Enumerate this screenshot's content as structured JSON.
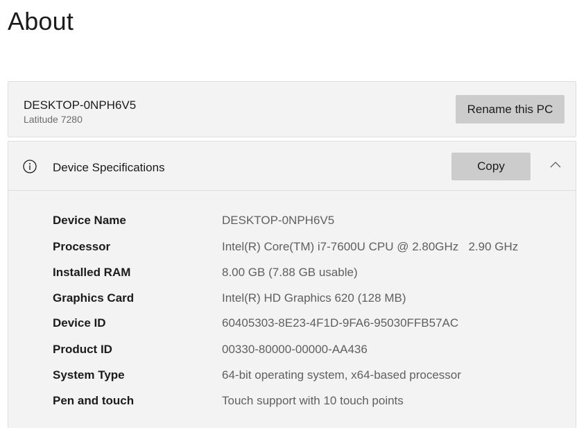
{
  "page": {
    "title": "About"
  },
  "pc": {
    "name": "DESKTOP-0NPH6V5",
    "model": "Latitude 7280",
    "rename_label": "Rename this PC"
  },
  "specs": {
    "title": "Device Specifications",
    "copy_label": "Copy",
    "icons": {
      "info": "info-icon",
      "collapse": "chevron-up-icon"
    },
    "rows": [
      {
        "label": "Device Name",
        "value": "DESKTOP-0NPH6V5"
      },
      {
        "label": "Processor",
        "value": "Intel(R) Core(TM) i7-7600U CPU @ 2.80GHz   2.90 GHz"
      },
      {
        "label": "Installed RAM",
        "value": "8.00 GB (7.88 GB usable)"
      },
      {
        "label": "Graphics Card",
        "value": "Intel(R) HD Graphics 620 (128 MB)"
      },
      {
        "label": "Device ID",
        "value": "60405303-8E23-4F1D-9FA6-95030FFB57AC"
      },
      {
        "label": "Product ID",
        "value": "00330-80000-00000-AA436"
      },
      {
        "label": "System Type",
        "value": "64-bit operating system, x64-based processor"
      },
      {
        "label": "Pen and touch",
        "value": "Touch support with 10 touch points"
      }
    ]
  },
  "colors": {
    "card_bg": "#f3f3f3",
    "button_bg": "#cccccc",
    "label_text": "#1b1b1b",
    "value_text": "#5f5f5f"
  }
}
